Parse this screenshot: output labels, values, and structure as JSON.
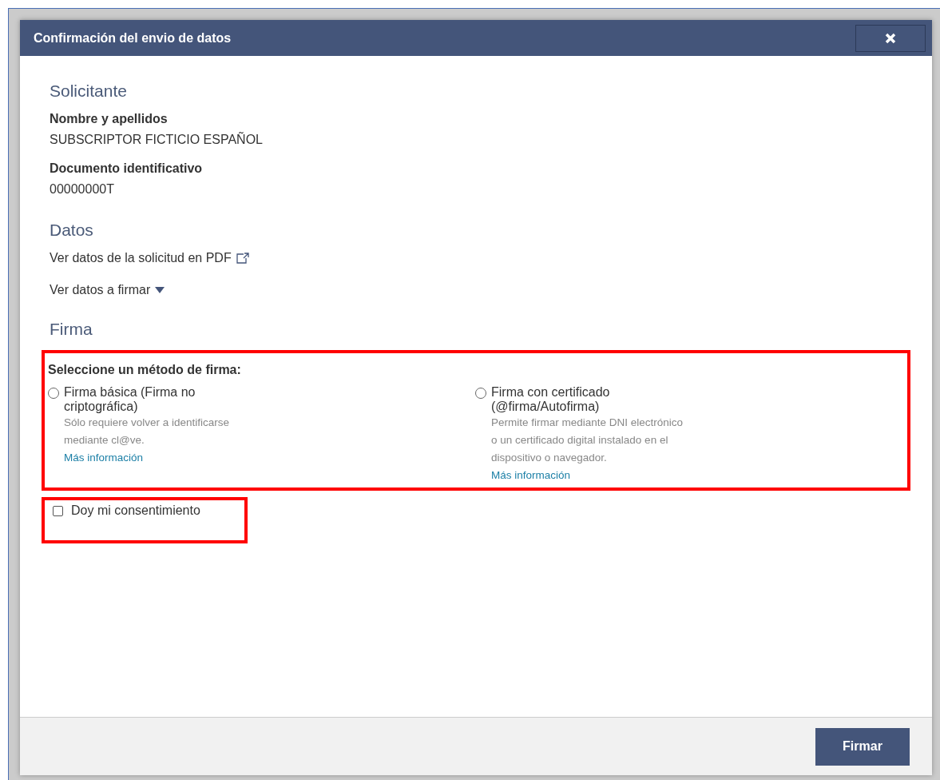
{
  "dialog": {
    "title": "Confirmación del envio de datos"
  },
  "solicitante": {
    "heading": "Solicitante",
    "fields": [
      {
        "label": "Nombre y apellidos",
        "value": "SUBSCRIPTOR FICTICIO ESPAÑOL"
      },
      {
        "label": "Documento identificativo",
        "value": "00000000T"
      }
    ]
  },
  "datos": {
    "heading": "Datos",
    "links": [
      {
        "kind": "external",
        "text": "Ver datos de la solicitud en PDF"
      },
      {
        "kind": "toggle",
        "text": "Ver datos a firmar",
        "expanded": false
      }
    ]
  },
  "firma": {
    "heading": "Firma",
    "highlighted": true,
    "prompt": "Seleccione un método de firma:",
    "options": [
      {
        "title": "Firma básica (Firma no criptográfica)",
        "description": "Sólo requiere volver a identificarse mediante cl@ve.",
        "link": "Más información",
        "selected": false
      },
      {
        "title": "Firma con certificado (@firma/Autofirma)",
        "description": "Permite firmar mediante DNI electrónico o un certificado digital instalado en el dispositivo o navegador.",
        "link": "Más información",
        "selected": false
      }
    ],
    "consent": {
      "label": "Doy mi consentimiento",
      "checked": false,
      "highlighted": true
    }
  },
  "footer": {
    "button": "Firmar"
  }
}
